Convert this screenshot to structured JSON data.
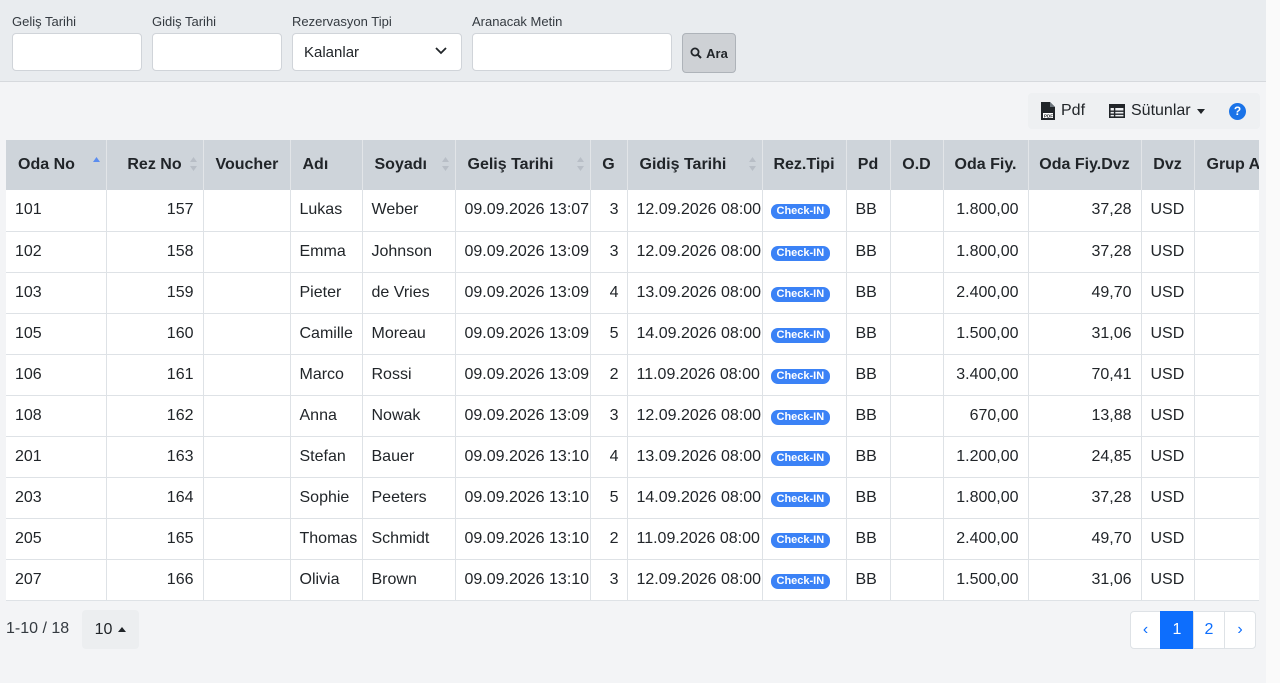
{
  "filters": {
    "arrival_label": "Geliş Tarihi",
    "arrival_value": "",
    "departure_label": "Gidiş Tarihi",
    "departure_value": "",
    "res_type_label": "Rezervasyon Tipi",
    "res_type_value": "Kalanlar",
    "search_label": "Aranacak Metin",
    "search_value": "",
    "search_button": "Ara",
    "search_icon": "search-icon"
  },
  "toolbar": {
    "pdf_label": "Pdf",
    "pdf_icon": "pdf-file-icon",
    "columns_label": "Sütunlar",
    "columns_icon": "table-icon",
    "help_label": "?"
  },
  "table": {
    "headers": [
      "Oda No",
      "Rez No",
      "Voucher",
      "Adı",
      "Soyadı",
      "Geliş Tarihi",
      "G",
      "Gidiş Tarihi",
      "Rez.Tipi",
      "Pd",
      "O.D",
      "Oda Fiy.",
      "Oda Fiy.Dvz",
      "Dvz",
      "Grup Adı"
    ],
    "sorted_column": "Oda No",
    "sort_direction": "ascending",
    "rows": [
      {
        "oda": "101",
        "rez": "157",
        "voucher": "",
        "ad": "Lukas",
        "soyad": "Weber",
        "gelis": "09.09.2026 13:07",
        "g": "3",
        "gidis": "12.09.2026 08:00",
        "tip": "Check-IN",
        "pd": "BB",
        "od": "",
        "fiy": "1.800,00",
        "dvzfiy": "37,28",
        "dvz": "USD",
        "grup": ""
      },
      {
        "oda": "102",
        "rez": "158",
        "voucher": "",
        "ad": "Emma",
        "soyad": "Johnson",
        "gelis": "09.09.2026 13:09",
        "g": "3",
        "gidis": "12.09.2026 08:00",
        "tip": "Check-IN",
        "pd": "BB",
        "od": "",
        "fiy": "1.800,00",
        "dvzfiy": "37,28",
        "dvz": "USD",
        "grup": ""
      },
      {
        "oda": "103",
        "rez": "159",
        "voucher": "",
        "ad": "Pieter",
        "soyad": "de Vries",
        "gelis": "09.09.2026 13:09",
        "g": "4",
        "gidis": "13.09.2026 08:00",
        "tip": "Check-IN",
        "pd": "BB",
        "od": "",
        "fiy": "2.400,00",
        "dvzfiy": "49,70",
        "dvz": "USD",
        "grup": ""
      },
      {
        "oda": "105",
        "rez": "160",
        "voucher": "",
        "ad": "Camille",
        "soyad": "Moreau",
        "gelis": "09.09.2026 13:09",
        "g": "5",
        "gidis": "14.09.2026 08:00",
        "tip": "Check-IN",
        "pd": "BB",
        "od": "",
        "fiy": "1.500,00",
        "dvzfiy": "31,06",
        "dvz": "USD",
        "grup": ""
      },
      {
        "oda": "106",
        "rez": "161",
        "voucher": "",
        "ad": "Marco",
        "soyad": "Rossi",
        "gelis": "09.09.2026 13:09",
        "g": "2",
        "gidis": "11.09.2026 08:00",
        "tip": "Check-IN",
        "pd": "BB",
        "od": "",
        "fiy": "3.400,00",
        "dvzfiy": "70,41",
        "dvz": "USD",
        "grup": ""
      },
      {
        "oda": "108",
        "rez": "162",
        "voucher": "",
        "ad": "Anna",
        "soyad": "Nowak",
        "gelis": "09.09.2026 13:09",
        "g": "3",
        "gidis": "12.09.2026 08:00",
        "tip": "Check-IN",
        "pd": "BB",
        "od": "",
        "fiy": "670,00",
        "dvzfiy": "13,88",
        "dvz": "USD",
        "grup": ""
      },
      {
        "oda": "201",
        "rez": "163",
        "voucher": "",
        "ad": "Stefan",
        "soyad": "Bauer",
        "gelis": "09.09.2026 13:10",
        "g": "4",
        "gidis": "13.09.2026 08:00",
        "tip": "Check-IN",
        "pd": "BB",
        "od": "",
        "fiy": "1.200,00",
        "dvzfiy": "24,85",
        "dvz": "USD",
        "grup": ""
      },
      {
        "oda": "203",
        "rez": "164",
        "voucher": "",
        "ad": "Sophie",
        "soyad": "Peeters",
        "gelis": "09.09.2026 13:10",
        "g": "5",
        "gidis": "14.09.2026 08:00",
        "tip": "Check-IN",
        "pd": "BB",
        "od": "",
        "fiy": "1.800,00",
        "dvzfiy": "37,28",
        "dvz": "USD",
        "grup": ""
      },
      {
        "oda": "205",
        "rez": "165",
        "voucher": "",
        "ad": "Thomas",
        "soyad": "Schmidt",
        "gelis": "09.09.2026 13:10",
        "g": "2",
        "gidis": "11.09.2026 08:00",
        "tip": "Check-IN",
        "pd": "BB",
        "od": "",
        "fiy": "2.400,00",
        "dvzfiy": "49,70",
        "dvz": "USD",
        "grup": ""
      },
      {
        "oda": "207",
        "rez": "166",
        "voucher": "",
        "ad": "Olivia",
        "soyad": "Brown",
        "gelis": "09.09.2026 13:10",
        "g": "3",
        "gidis": "12.09.2026 08:00",
        "tip": "Check-IN",
        "pd": "BB",
        "od": "",
        "fiy": "1.500,00",
        "dvzfiy": "31,06",
        "dvz": "USD",
        "grup": ""
      }
    ]
  },
  "footer": {
    "range_text": "1-10 / 18",
    "page_size": "10",
    "pages": [
      "‹",
      "1",
      "2",
      "›"
    ],
    "current_page": "1"
  },
  "colors": {
    "accent": "#0d6efd",
    "badge": "#3b82f6",
    "header_bg": "#ced4da"
  }
}
